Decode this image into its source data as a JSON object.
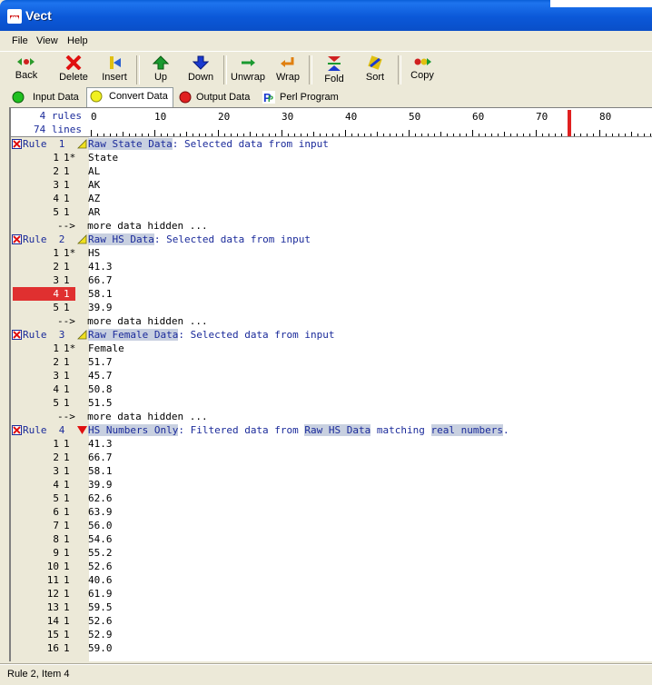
{
  "window": {
    "title": "Vect"
  },
  "menu": [
    "File",
    "View",
    "Help"
  ],
  "toolbar": {
    "back": "Back",
    "delete": "Delete",
    "insert": "Insert",
    "up": "Up",
    "down": "Down",
    "unwrap": "Unwrap",
    "wrap": "Wrap",
    "fold": "Fold",
    "sort": "Sort",
    "copy": "Copy"
  },
  "tabs": [
    "Input Data",
    "Convert Data",
    "Output Data",
    "Perl Program"
  ],
  "ruler": {
    "rules": "4 rules",
    "lines": "74 lines",
    "ticks": [
      "0",
      "10",
      "20",
      "30",
      "40",
      "50",
      "60",
      "70",
      "80"
    ],
    "cursor_column": 75
  },
  "rules": [
    {
      "label": "Rule  1",
      "name": "Raw State Data",
      "desc": ": Selected data from input",
      "rows": [
        [
          "1",
          "1*",
          "State"
        ],
        [
          "2",
          "1",
          "AL"
        ],
        [
          "3",
          "1",
          "AK"
        ],
        [
          "4",
          "1",
          "AZ"
        ],
        [
          "5",
          "1",
          "AR"
        ]
      ],
      "more": "-->  more data hidden ..."
    },
    {
      "label": "Rule  2",
      "name": "Raw HS Data",
      "desc": ": Selected data from input",
      "rows": [
        [
          "1",
          "1*",
          "HS"
        ],
        [
          "2",
          "1",
          "41.3"
        ],
        [
          "3",
          "1",
          "66.7"
        ],
        [
          "4",
          "1",
          "58.1"
        ],
        [
          "5",
          "1",
          "39.9"
        ]
      ],
      "more": "-->  more data hidden ..."
    },
    {
      "label": "Rule  3",
      "name": "Raw Female Data",
      "desc": ": Selected data from input",
      "rows": [
        [
          "1",
          "1*",
          "Female"
        ],
        [
          "2",
          "1",
          "51.7"
        ],
        [
          "3",
          "1",
          "45.7"
        ],
        [
          "4",
          "1",
          "50.8"
        ],
        [
          "5",
          "1",
          "51.5"
        ]
      ],
      "more": "-->  more data hidden ..."
    },
    {
      "label": "Rule  4",
      "name": "HS Numbers Only",
      "desc_a": ": Filtered data from ",
      "ref": "Raw HS Data",
      "desc_b": " matching ",
      "pattern": "real numbers",
      "desc_c": ".",
      "rows": [
        [
          "1",
          "1",
          "41.3"
        ],
        [
          "2",
          "1",
          "66.7"
        ],
        [
          "3",
          "1",
          "58.1"
        ],
        [
          "4",
          "1",
          "39.9"
        ],
        [
          "5",
          "1",
          "62.6"
        ],
        [
          "6",
          "1",
          "63.9"
        ],
        [
          "7",
          "1",
          "56.0"
        ],
        [
          "8",
          "1",
          "54.6"
        ],
        [
          "9",
          "1",
          "55.2"
        ],
        [
          "10",
          "1",
          "52.6"
        ],
        [
          "11",
          "1",
          "40.6"
        ],
        [
          "12",
          "1",
          "61.9"
        ],
        [
          "13",
          "1",
          "59.5"
        ],
        [
          "14",
          "1",
          "52.6"
        ],
        [
          "15",
          "1",
          "52.9"
        ],
        [
          "16",
          "1",
          "59.0"
        ]
      ]
    }
  ],
  "status": "Rule 2, Item 4",
  "colors": {
    "title_bar": "#0a5fd8",
    "highlight": "#e03030",
    "rule_text": "#1a2a9a",
    "chip": "#c8d0e0"
  }
}
